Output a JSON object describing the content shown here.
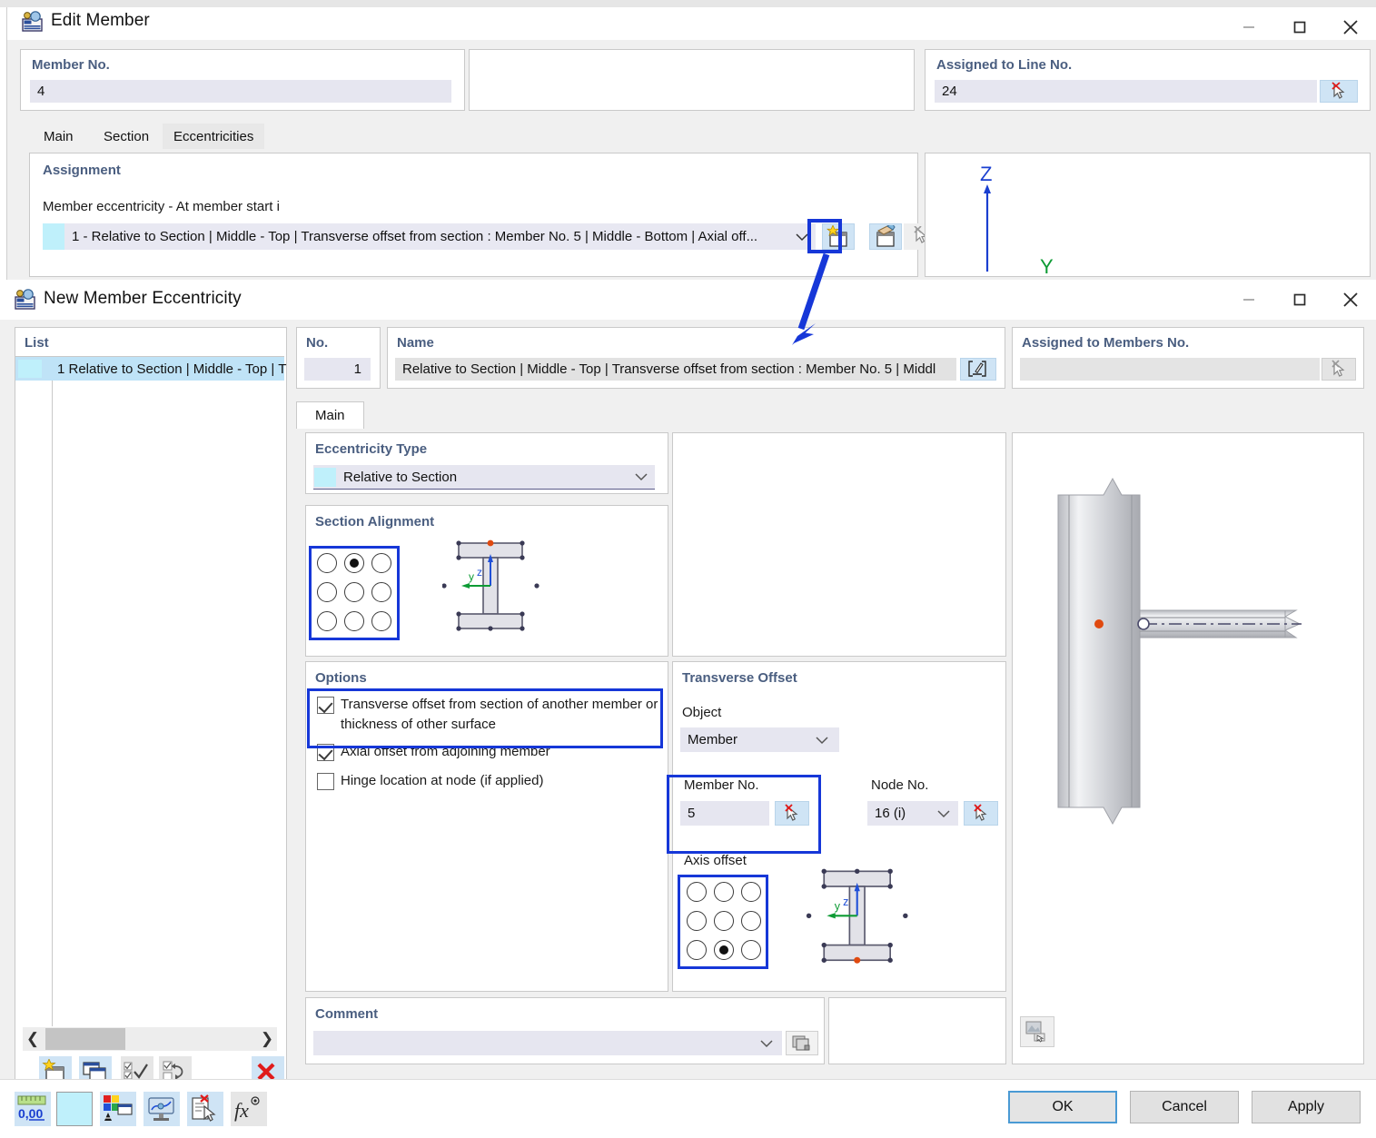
{
  "edit_member_window": {
    "title": "Edit Member",
    "icon": "member-icon",
    "buttons": {
      "minimize": "minimize-icon",
      "maximize": "maximize-icon",
      "close": "close-icon"
    },
    "member_no": {
      "label": "Member No.",
      "value": "4"
    },
    "assigned_to_line": {
      "label": "Assigned to Line No.",
      "value": "24",
      "pick_icon": "pick-cursor-icon"
    },
    "tabs": [
      {
        "label": "Main",
        "selected": false
      },
      {
        "label": "Section",
        "selected": false
      },
      {
        "label": "Eccentricities",
        "selected": true
      }
    ],
    "assignment": {
      "heading": "Assignment",
      "sublabel": "Member eccentricity - At member start i",
      "value": "1 - Relative to Section | Middle - Top | Transverse offset from section : Member No. 5 | Middle - Bottom | Axial off...",
      "new_button_icon": "new-item-icon",
      "edit_button_icon": "edit-item-icon",
      "pick_button_icon": "pick-cursor-icon"
    },
    "preview_axes": {
      "z": "Z",
      "y": "Y"
    }
  },
  "new_eccentricity_window": {
    "title": "New Member Eccentricity",
    "icon": "member-icon",
    "buttons": {
      "minimize": "minimize-icon",
      "maximize": "maximize-icon",
      "close": "close-icon"
    },
    "list": {
      "header": "List",
      "items": [
        {
          "no": "1",
          "text": "1 Relative to Section | Middle - Top | T"
        }
      ],
      "scroll_left_icon": "chevron-left-icon",
      "scroll_right_icon": "chevron-right-icon",
      "toolbar": [
        {
          "name": "new-eccentricity-button",
          "icon": "new-item-icon",
          "enabled": true
        },
        {
          "name": "copy-eccentricity-button",
          "icon": "copy-item-icon",
          "enabled": true
        },
        {
          "name": "select-all-button",
          "icon": "check-all-icon",
          "enabled": false
        },
        {
          "name": "invert-selection-button",
          "icon": "invert-selection-icon",
          "enabled": false
        },
        {
          "name": "delete-eccentricity-button",
          "icon": "delete-x-icon",
          "enabled": true
        }
      ]
    },
    "no_field": {
      "label": "No.",
      "value": "1"
    },
    "name_field": {
      "label": "Name",
      "value": "Relative to Section | Middle - Top | Transverse offset from section : Member No. 5 | Middl",
      "edit_icon": "edit-text-icon"
    },
    "assigned_to_members": {
      "label": "Assigned to Members No.",
      "value": "",
      "pick_icon": "pick-cursor-icon"
    },
    "tabs": [
      {
        "label": "Main",
        "selected": true
      }
    ],
    "eccentricity_type": {
      "heading": "Eccentricity Type",
      "value": "Relative to Section",
      "caret_icon": "chevron-down-icon"
    },
    "section_alignment": {
      "heading": "Section Alignment",
      "grid": [
        [
          false,
          true,
          false
        ],
        [
          false,
          false,
          false
        ],
        [
          false,
          false,
          false
        ]
      ],
      "diagram": {
        "z_label": "z",
        "y_label": "y",
        "marker": "top-middle"
      }
    },
    "options": {
      "heading": "Options",
      "items": [
        {
          "label": "Transverse offset from section of another member or thickness of other surface",
          "checked": true
        },
        {
          "label": "Axial offset from adjoining member",
          "checked": true
        },
        {
          "label": "Hinge location at node (if applied)",
          "checked": false
        }
      ]
    },
    "transverse_offset": {
      "heading": "Transverse Offset",
      "object_label": "Object",
      "object_value": "Member",
      "object_caret_icon": "chevron-down-icon",
      "member_no_label": "Member No.",
      "member_no_value": "5",
      "member_pick_icon": "pick-cursor-icon",
      "node_no_label": "Node No.",
      "node_no_value": "16 (i)",
      "node_caret_icon": "chevron-down-icon",
      "node_pick_icon": "pick-cursor-icon",
      "axis_offset_label": "Axis offset",
      "axis_grid": [
        [
          false,
          false,
          false
        ],
        [
          false,
          false,
          false
        ],
        [
          false,
          true,
          false
        ]
      ],
      "diagram": {
        "z_label": "z",
        "y_label": "y",
        "marker": "bottom-middle"
      }
    },
    "comment": {
      "heading": "Comment",
      "value": "",
      "caret_icon": "chevron-down-icon",
      "clipboard_icon": "clipboard-copy-icon"
    },
    "preview": {
      "camera_icon": "render-settings-icon"
    },
    "bottom_toolbar": [
      {
        "name": "units-button",
        "icon": "units-000-icon",
        "label": "0,00"
      },
      {
        "name": "color-swatch-button",
        "icon": "color-swatch-icon"
      },
      {
        "name": "display-properties-button",
        "icon": "display-properties-icon"
      },
      {
        "name": "view-settings-button",
        "icon": "view-settings-icon"
      },
      {
        "name": "delete-selection-button",
        "icon": "delete-selection-icon"
      },
      {
        "name": "formula-button",
        "icon": "formula-fx-icon"
      }
    ],
    "footer_buttons": {
      "ok": "OK",
      "cancel": "Cancel",
      "apply": "Apply"
    }
  },
  "annotation": {
    "arrow_color": "#1637d8",
    "highlight_color": "#1637d8"
  }
}
